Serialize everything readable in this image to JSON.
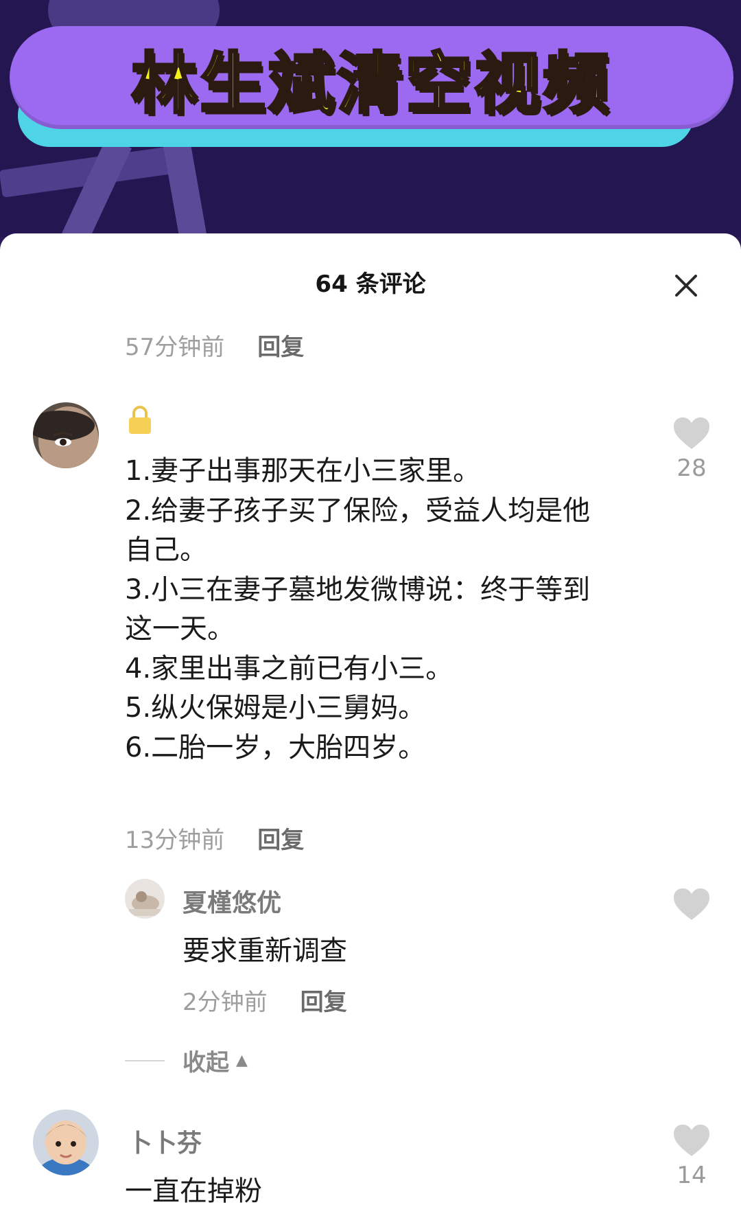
{
  "banner": {
    "title": "林生斌清空视频"
  },
  "panel": {
    "title": "64 条评论",
    "close_icon": "close-icon"
  },
  "previous_comment": {
    "time": "57分钟前",
    "reply": "回复"
  },
  "comment1": {
    "lines": [
      "1.妻子出事那天在小三家里。",
      "2.给妻子孩子买了保险，受益人均是他",
      "自己。",
      "3.小三在妻子墓地发微博说：终于等到",
      "这一天。",
      "4.家里出事之前已有小三。",
      "5.纵火保姆是小三舅妈。",
      "6.二胎一岁，大胎四岁。"
    ],
    "likes": "28",
    "time": "13分钟前",
    "reply": "回复"
  },
  "reply1": {
    "username": "夏槿悠优",
    "text": "要求重新调查",
    "time": "2分钟前",
    "reply": "回复"
  },
  "collapse": {
    "label": "收起"
  },
  "comment2": {
    "username": "卜卜芬",
    "text": "一直在掉粉",
    "likes": "14"
  },
  "colors": {
    "banner_purple": "#9b6af0",
    "banner_cyan": "#4fd3e6",
    "banner_text": "#f4f020",
    "like_gray": "#d2d2d2"
  }
}
